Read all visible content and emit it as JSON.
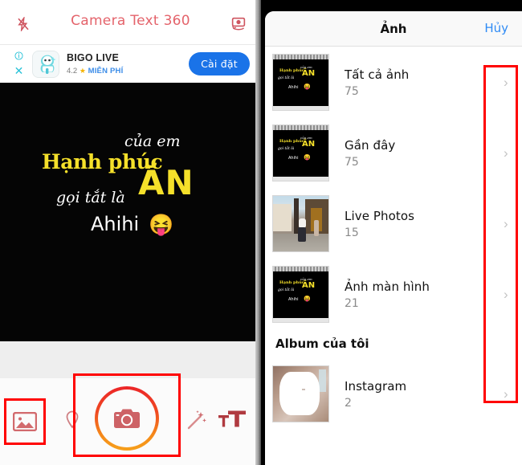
{
  "left_panel": {
    "app_title": "Camera Text 360",
    "flash_icon": "flash-off-icon",
    "flip_icon": "camera-flip-icon",
    "ad": {
      "info_icon": "info-icon",
      "close_icon": "close-icon",
      "app_icon": "bigo-live-app-icon",
      "title": "BIGO LIVE",
      "rating": "4.2",
      "star": "★",
      "free_label": "MIỄN PHÍ",
      "cta_label": "Cài đặt",
      "cta_color": "#1a73e8"
    },
    "preview": {
      "line1_yellow": "Hạnh phúc",
      "line1_white": "của em",
      "line2_white": "gọi tắt là",
      "line2_yellow": "ĂN",
      "line3": "Ahihi",
      "emoji": "😝",
      "text_accent": "#f5e02a",
      "background": "#050505"
    },
    "toolbar": {
      "gallery_icon": "gallery-icon",
      "pin_icon": "location-pin-icon",
      "shutter_icon": "camera-shutter-icon",
      "wand_icon": "magic-wand-icon",
      "text_icon": "text-size-icon",
      "shutter_gradient_start": "#ec2528",
      "shutter_gradient_end": "#f6a01b"
    },
    "highlights": {
      "color": "#ff0000",
      "gallery_box": "gallery-button-highlight",
      "shutter_box": "shutter-button-highlight"
    }
  },
  "right_panel": {
    "nav": {
      "title": "Ảnh",
      "cancel_label": "Hủy",
      "cancel_color": "#2f8bf5"
    },
    "albums": [
      {
        "label": "Tất cả ảnh",
        "count": "75",
        "thumb": "meme",
        "chevron": "chevron-right-icon"
      },
      {
        "label": "Gần đây",
        "count": "75",
        "thumb": "meme",
        "chevron": "chevron-right-icon"
      },
      {
        "label": "Live Photos",
        "count": "15",
        "thumb": "street",
        "chevron": "chevron-right-icon"
      },
      {
        "label": "Ảnh màn hình",
        "count": "21",
        "thumb": "meme",
        "chevron": "chevron-right-icon"
      }
    ],
    "section_title": "Album của tôi",
    "my_albums": [
      {
        "label": "Instagram",
        "count": "2",
        "thumb": "insta",
        "chevron": "chevron-right-icon"
      }
    ],
    "highlights": {
      "color": "#ff0000",
      "chevron_column_box": "chevron-column-highlight"
    },
    "thumb_meme": {
      "m1": "Hạnh phúc",
      "m2": "của em",
      "m3": "gọi tắt là",
      "m4": "ĂN",
      "m5": "Ahihi",
      "m6": "😝"
    }
  }
}
